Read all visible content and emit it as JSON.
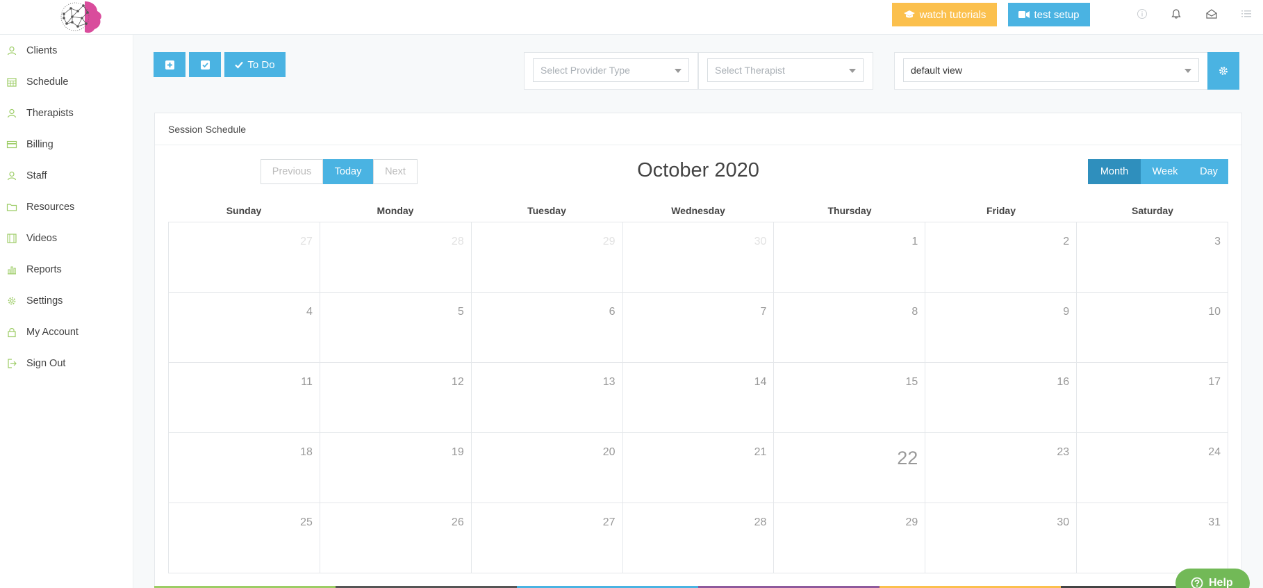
{
  "header": {
    "tutorials_label": "watch tutorials",
    "test_setup_label": "test setup",
    "colors": {
      "tutorials": "#fbc04d",
      "test_setup": "#4ab3e2",
      "logo": "#d94c9c"
    }
  },
  "sidebar": {
    "items": [
      {
        "label": "Clients",
        "icon": "user-icon"
      },
      {
        "label": "Schedule",
        "icon": "calendar-icon"
      },
      {
        "label": "Therapists",
        "icon": "user-icon"
      },
      {
        "label": "Billing",
        "icon": "credit-card-icon"
      },
      {
        "label": "Staff",
        "icon": "user-icon"
      },
      {
        "label": "Resources",
        "icon": "folder-icon"
      },
      {
        "label": "Videos",
        "icon": "film-icon"
      },
      {
        "label": "Reports",
        "icon": "bar-chart-icon"
      },
      {
        "label": "Settings",
        "icon": "gear-icon"
      },
      {
        "label": "My Account",
        "icon": "lock-icon"
      },
      {
        "label": "Sign Out",
        "icon": "sign-out-icon"
      }
    ]
  },
  "toolbar": {
    "todo_label": "To Do",
    "provider_type_placeholder": "Select Provider Type",
    "therapist_placeholder": "Select Therapist",
    "view_select_value": "default view"
  },
  "panel": {
    "title": "Session Schedule"
  },
  "calendar": {
    "prev_label": "Previous",
    "today_label": "Today",
    "next_label": "Next",
    "month_title": "October 2020",
    "views": {
      "month": "Month",
      "week": "Week",
      "day": "Day"
    },
    "weekdays": [
      "Sunday",
      "Monday",
      "Tuesday",
      "Wednesday",
      "Thursday",
      "Friday",
      "Saturday"
    ],
    "weeks": [
      [
        "27",
        "28",
        "29",
        "30",
        "1",
        "2",
        "3"
      ],
      [
        "4",
        "5",
        "6",
        "7",
        "8",
        "9",
        "10"
      ],
      [
        "11",
        "12",
        "13",
        "14",
        "15",
        "16",
        "17"
      ],
      [
        "18",
        "19",
        "20",
        "21",
        "22",
        "23",
        "24"
      ],
      [
        "25",
        "26",
        "27",
        "28",
        "29",
        "30",
        "31"
      ]
    ],
    "other_month_days": [
      "27",
      "28",
      "29",
      "30"
    ],
    "today": "22"
  },
  "help": {
    "label": "Help"
  }
}
